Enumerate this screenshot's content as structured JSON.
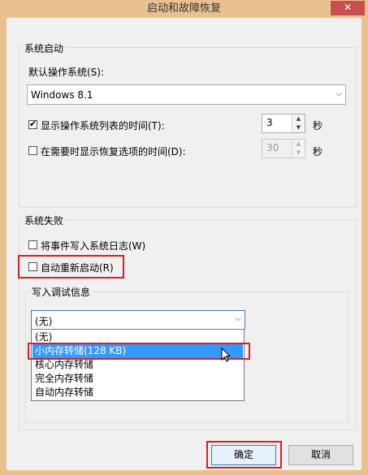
{
  "window": {
    "title": "启动和故障恢复",
    "close_glyph": "✕"
  },
  "startup": {
    "legend": "系统启动",
    "default_os_label": "默认操作系统(S):",
    "default_os_value": "Windows 8.1",
    "show_os_list": {
      "checked": true,
      "label": "显示操作系统列表的时间(T):",
      "value": "3",
      "unit": "秒"
    },
    "show_recovery": {
      "checked": false,
      "label": "在需要时显示恢复选项的时间(D):",
      "value": "30",
      "unit": "秒"
    }
  },
  "failure": {
    "legend": "系统失败",
    "write_log": {
      "checked": false,
      "label": "将事件写入系统日志(W)"
    },
    "auto_restart": {
      "checked": false,
      "label": "自动重新启动(R)"
    },
    "debug": {
      "legend": "写入调试信息",
      "selected": "(无)",
      "options": [
        "(无)",
        "小内存转储(128 KB)",
        "核心内存转储",
        "完全内存转储",
        "自动内存转储"
      ],
      "highlighted_index": 1
    }
  },
  "buttons": {
    "ok": "确定",
    "cancel": "取消"
  },
  "colors": {
    "frame": "#e9c08f",
    "highlight_box": "#d61f26",
    "selection": "#3399ff"
  }
}
